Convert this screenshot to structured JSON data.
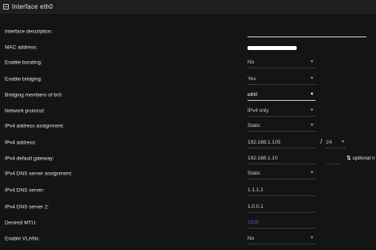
{
  "window": {
    "title": "Interface eth0",
    "icon": "window-icon"
  },
  "rows": {
    "description": {
      "label": "Interface description:",
      "value": ""
    },
    "mac": {
      "label": "MAC address:"
    },
    "bonding": {
      "label": "Enable bonding:",
      "value": "No"
    },
    "bridging": {
      "label": "Enable bridging:",
      "value": "Yes"
    },
    "bridge_members": {
      "label": "Bridging members of br0:",
      "value": "eth0"
    },
    "network_protocol": {
      "label": "Network protocol:",
      "value": "IPv4 only"
    },
    "ipv4_assignment": {
      "label": "IPv4 address assignment:",
      "value": "Static"
    },
    "ipv4_address": {
      "label": "IPv4 address:",
      "value": "192.168.1.105",
      "slash": "/",
      "prefix": "24"
    },
    "ipv4_gateway": {
      "label": "IPv4 default gateway:",
      "value": "192.168.1.10",
      "optional_icon": "swap-vertical-icon",
      "optional_text": "optional n"
    },
    "dns_assignment": {
      "label": "IPv4 DNS server assignment:",
      "value": "Static"
    },
    "dns1": {
      "label": "IPv4 DNS server:",
      "value": "1.1.1.1"
    },
    "dns2": {
      "label": "IPv4 DNS server 2:",
      "value": "1.0.0.1"
    },
    "mtu": {
      "label": "Desired MTU:",
      "value": "1500"
    },
    "vlans": {
      "label": "Enable VLANs:",
      "value": "No"
    }
  },
  "colors": {
    "background": "#141414",
    "placeholder_blue": "#3f62b8"
  }
}
